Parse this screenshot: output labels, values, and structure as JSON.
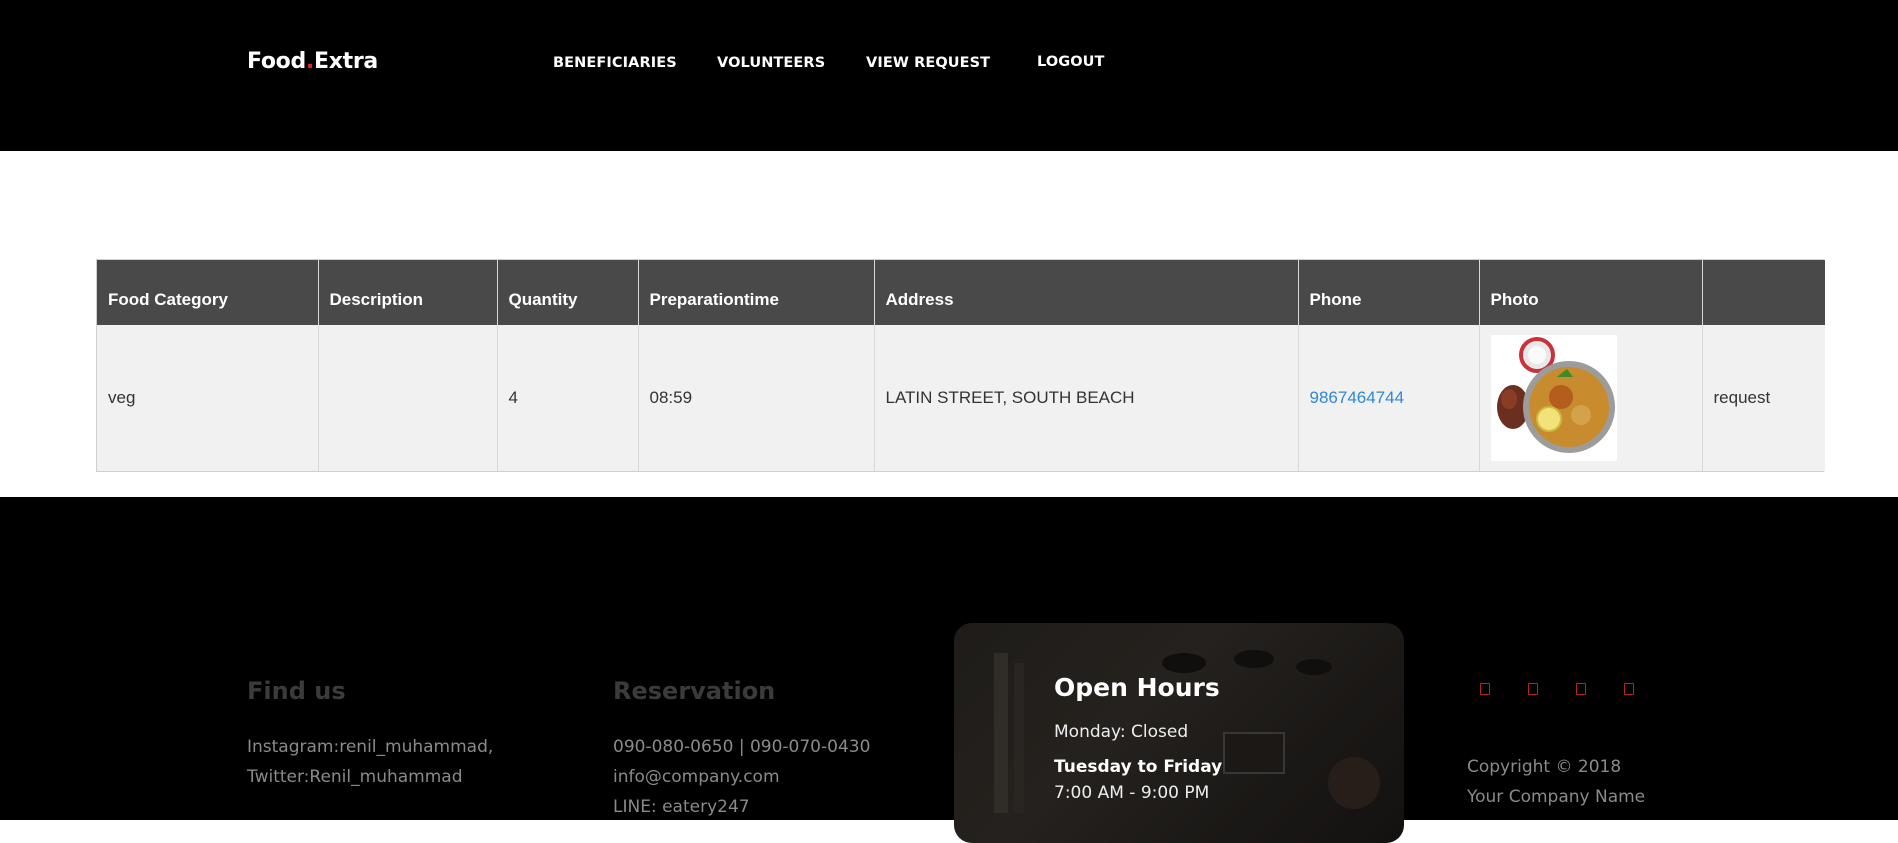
{
  "header": {
    "logo_left": "Food",
    "logo_dot": ".",
    "logo_right": "Extra",
    "nav": {
      "beneficiaries": "BENEFICIARIES",
      "volunteers": "VOLUNTEERS",
      "view_request": "VIEW REQUEST",
      "logout": "LOGOUT"
    }
  },
  "table": {
    "headers": [
      "Food Category",
      "Description",
      "Quantity",
      "Preparationtime",
      "Address",
      "Phone",
      "Photo",
      ""
    ],
    "rows": [
      {
        "food_category": "veg",
        "description": "",
        "quantity": "4",
        "preparation_time": "08:59",
        "address": "LATIN STREET, SOUTH BEACH",
        "phone": "9867464744",
        "action": "request"
      }
    ]
  },
  "footer": {
    "find_us": {
      "title": "Find us",
      "line1": "Instagram:renil_muhammad,",
      "line2": "Twitter:Renil_muhammad"
    },
    "reservation": {
      "title": "Reservation",
      "line1": "090-080-0650 | 090-070-0430",
      "line2": "info@company.com",
      "line3": "LINE: eatery247"
    },
    "open_hours": {
      "title": "Open Hours",
      "monday": "Monday: Closed",
      "tue_fri_label": "Tuesday to Friday",
      "tue_fri_hours": "7:00 AM - 9:00 PM"
    },
    "copyright": {
      "line1": "Copyright © 2018",
      "line2": "Your Company Name"
    },
    "social_icons": [
      "facebook-icon",
      "twitter-icon",
      "instagram-icon",
      "google-icon"
    ]
  },
  "colors": {
    "brand_red": "#e6222b",
    "link_blue": "#2f87d8",
    "table_header": "#494949"
  }
}
